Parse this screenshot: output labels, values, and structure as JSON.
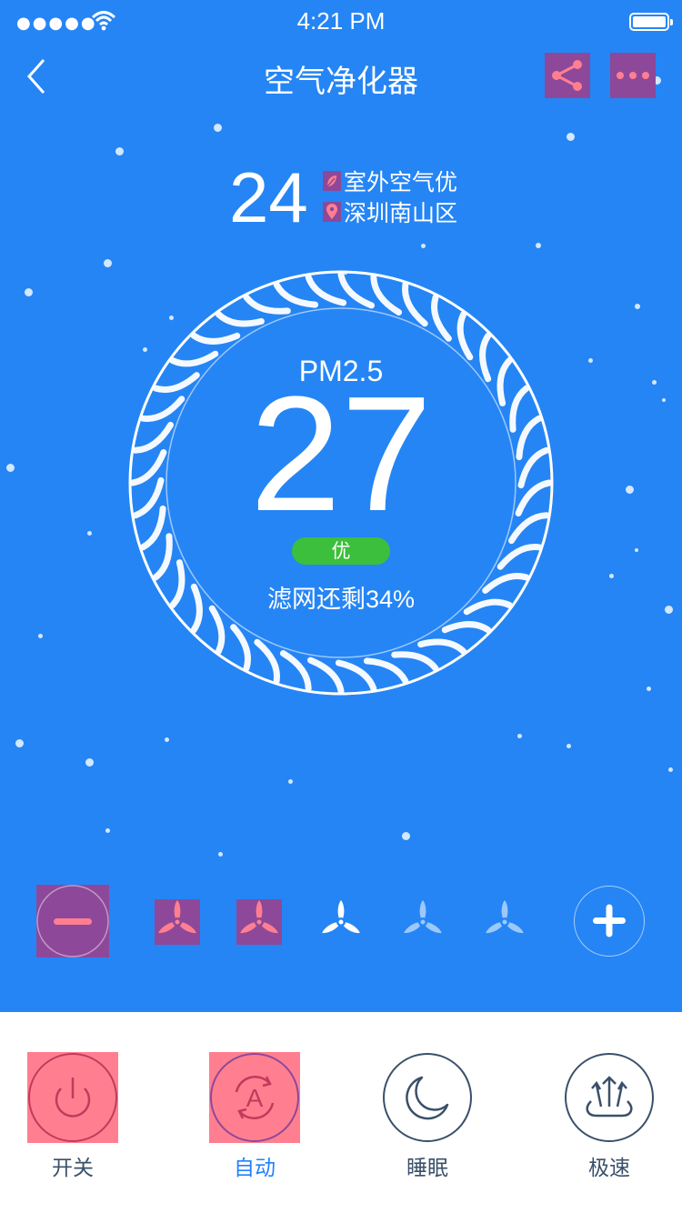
{
  "status_bar": {
    "signal": "●●●●●",
    "time": "4:21 PM"
  },
  "header": {
    "title": "空气净化器"
  },
  "weather": {
    "temperature": "24",
    "outdoor_air": "室外空气优",
    "location": "深圳南山区"
  },
  "pm": {
    "label": "PM2.5",
    "value": "27",
    "quality": "优",
    "filter_remaining": "滤网还剩34%"
  },
  "fan_speed": {
    "level": 2,
    "max": 5
  },
  "modes": [
    {
      "label": "开关",
      "icon": "power-icon",
      "active": false
    },
    {
      "label": "自动",
      "icon": "auto-mode-icon",
      "active": true
    },
    {
      "label": "睡眠",
      "icon": "moon-icon",
      "active": false
    },
    {
      "label": "极速",
      "icon": "turbo-icon",
      "active": false
    }
  ],
  "colors": {
    "background": "#2585f5",
    "label": "#3A506A",
    "active_label": "#2181ff",
    "quality_badge": "#3cbf3c"
  }
}
